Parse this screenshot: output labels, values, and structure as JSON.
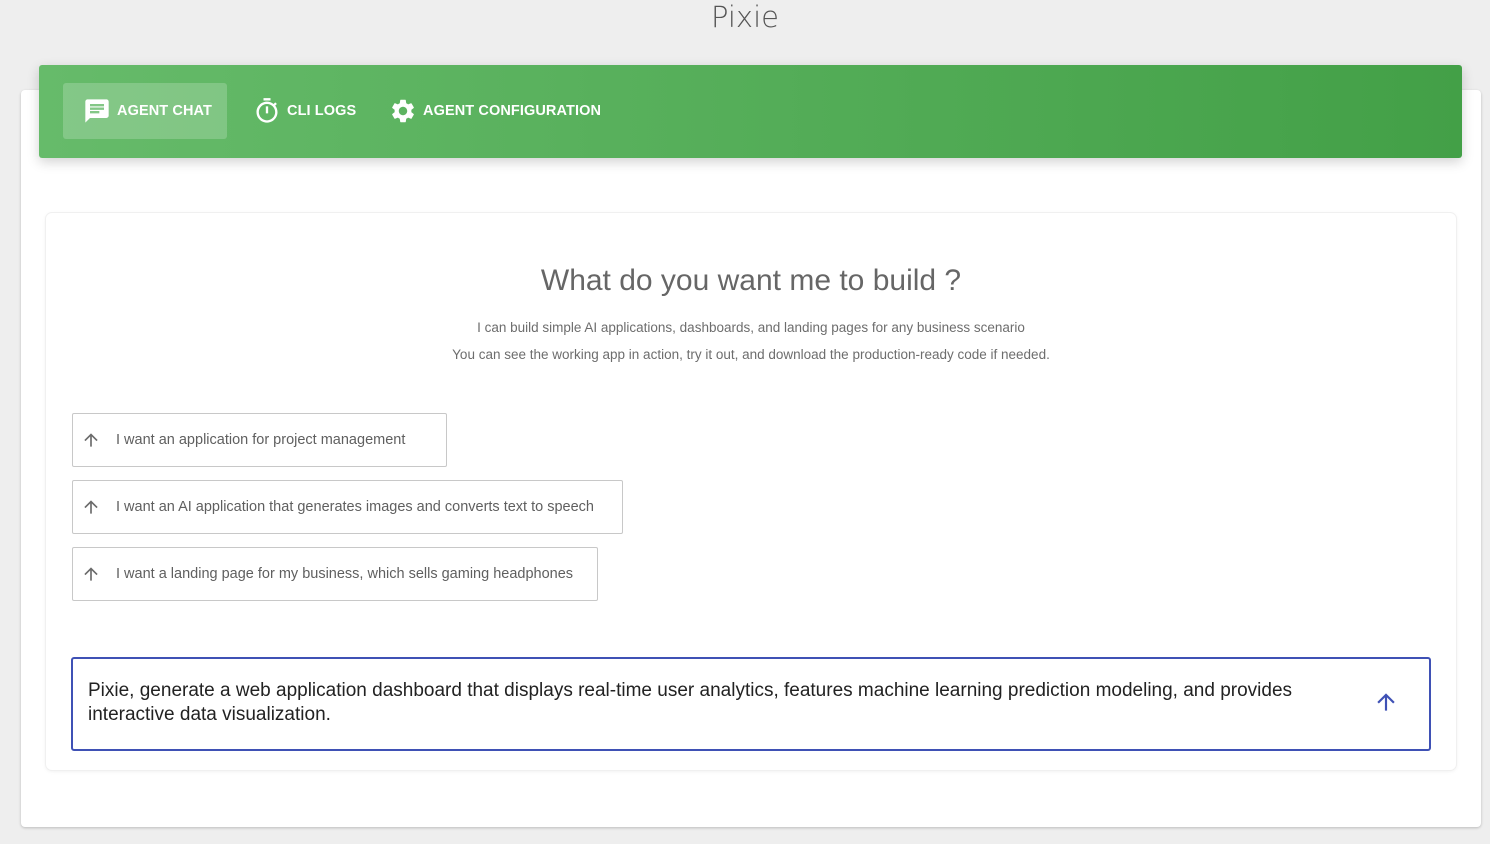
{
  "app": {
    "title": "Pixie"
  },
  "tabs": [
    {
      "label": "AGENT CHAT",
      "icon": "chat-message-icon",
      "active": true
    },
    {
      "label": "CLI LOGS",
      "icon": "stopwatch-icon",
      "active": false
    },
    {
      "label": "AGENT CONFIGURATION",
      "icon": "gear-icon",
      "active": false
    }
  ],
  "main": {
    "heading": "What do you want me to build ?",
    "subtitle_line1": "I can build simple AI applications, dashboards, and landing pages for any business scenario",
    "subtitle_line2": "You can see the working app in action, try it out, and download the production-ready code if needed."
  },
  "suggestions": [
    {
      "label": "I want an application for project management",
      "icon": "arrow-up-icon"
    },
    {
      "label": "I want an AI application that generates images and converts text to speech",
      "icon": "arrow-up-icon"
    },
    {
      "label": "I want a landing page for my business, which sells gaming headphones",
      "icon": "arrow-up-icon"
    }
  ],
  "prompt": {
    "value": "Pixie, generate a web application dashboard that displays real-time user analytics, features machine learning prediction modeling, and provides interactive data visualization.",
    "send_icon": "arrow-up-icon"
  },
  "colors": {
    "tabbar_start": "#66bb6a",
    "tabbar_end": "#43a047",
    "prompt_border": "#3f51b5",
    "send_icon": "#3f51b5",
    "background": "#eeeeee"
  }
}
